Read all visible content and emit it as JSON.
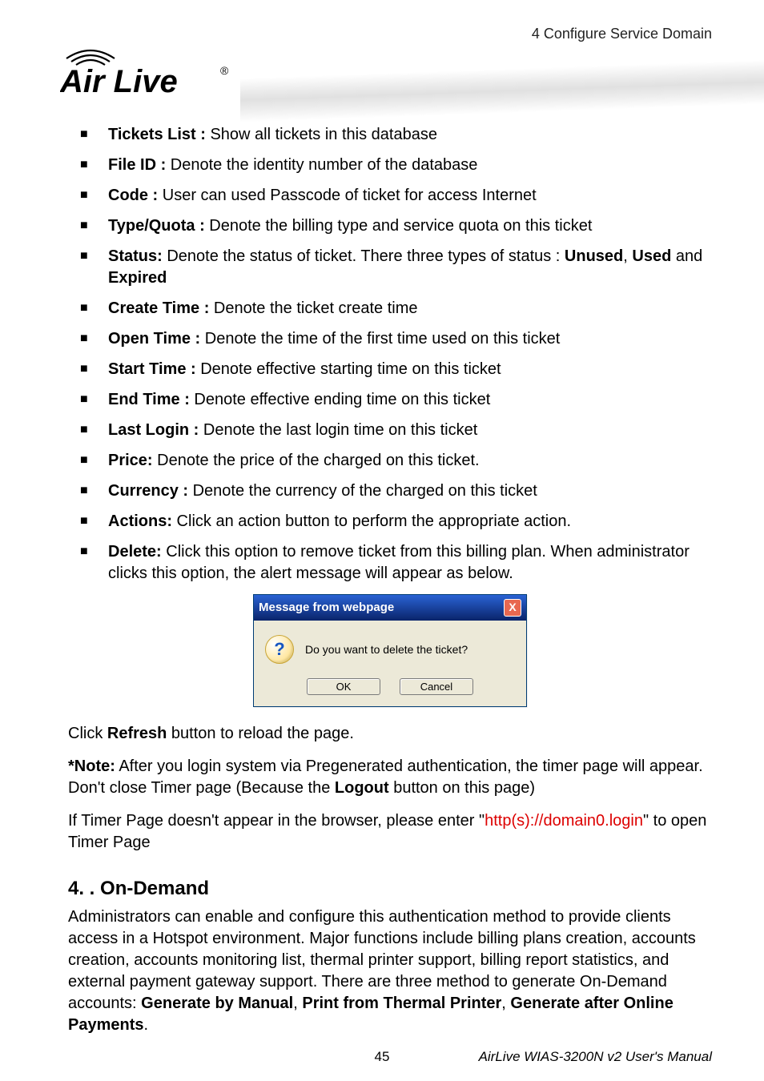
{
  "header": {
    "breadcrumb": "4  Configure  Service  Domain",
    "logo_text": "Air Live",
    "logo_reg": "®"
  },
  "bullets": [
    {
      "label": "Tickets List :",
      "text": "   Show all tickets in this database"
    },
    {
      "label": "File ID :",
      "text": " Denote the identity number of the database"
    },
    {
      "label": "Code :",
      "text": " User can used Passcode of ticket for access Internet"
    },
    {
      "label": "Type/Quota :",
      "text": " Denote the billing type and service quota on this ticket"
    },
    {
      "label": "Status:",
      "text_a": " Denote the status of ticket. There three types of status : ",
      "b1": "Unused",
      "sep1": ", ",
      "b2": "Used",
      "sep2": " and ",
      "b3": "Expired"
    },
    {
      "label": "Create Time :",
      "text": " Denote the ticket create time"
    },
    {
      "label": "Open Time :",
      "text": " Denote the time of the first time used on this ticket"
    },
    {
      "label": "Start Time :",
      "text": " Denote effective starting time on this ticket"
    },
    {
      "label": "End Time :",
      "text": " Denote effective ending time on this ticket"
    },
    {
      "label": "Last Login :",
      "text": " Denote the last login time on this ticket"
    },
    {
      "label": "Price:",
      "text": " Denote the price of the charged on this ticket."
    },
    {
      "label": "Currency :",
      "text": " Denote the currency of the charged on this ticket"
    },
    {
      "label": "Actions:",
      "text": " Click an action button to perform the appropriate action."
    },
    {
      "label": "Delete:",
      "text": " Click this option to remove ticket from this billing plan. When administrator clicks this option, the alert message will appear as below."
    }
  ],
  "dialog": {
    "title": "Message from webpage",
    "close": "X",
    "qmark": "?",
    "message": "Do you want to delete the ticket?",
    "ok": "OK",
    "cancel": "Cancel"
  },
  "refresh": {
    "a": "Click ",
    "b": "Refresh",
    "c": " button to reload the page."
  },
  "note": {
    "a": "*Note:",
    "b": " After you login system via Pregenerated authentication, the timer page will appear. Don't close Timer page (Because the ",
    "c": "Logout",
    "d": " button on this page)"
  },
  "timer": {
    "a": "If Timer Page doesn't appear in the browser, please enter \"",
    "b": "http(s)://domain0.login",
    "c": "\" to open Timer Page"
  },
  "section": {
    "num": "4.  .",
    "title": "  On-Demand"
  },
  "section_body": {
    "a": "Administrators can enable and configure this authentication method to provide clients access in a Hotspot environment. Major functions include billing plans creation, accounts creation, accounts monitoring list, thermal printer support, billing report statistics, and external payment gateway support. There are three method to generate On-Demand accounts: ",
    "b": "Generate by Manual",
    "s1": ", ",
    "c": "Print from Thermal Printer",
    "s2": ", ",
    "d": "Generate after Online Payments",
    "e": "."
  },
  "footer": {
    "page": "45",
    "manual": "AirLive WIAS-3200N v2 User's Manual"
  }
}
